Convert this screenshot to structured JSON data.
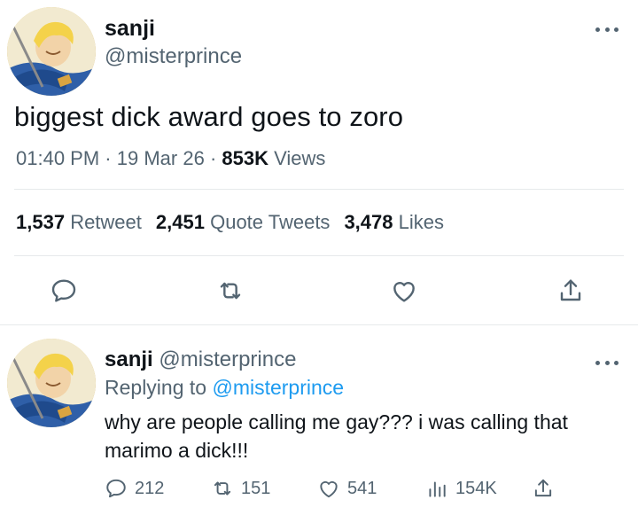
{
  "tweet": {
    "display_name": "sanji",
    "handle": "@misterprince",
    "text": "biggest dick award goes to zoro",
    "time": "01:40 PM",
    "date": "19 Mar 26",
    "views_count": "853K",
    "views_label": "Views",
    "stats": {
      "retweets_count": "1,537",
      "retweets_label": "Retweet",
      "quotes_count": "2,451",
      "quotes_label": "Quote Tweets",
      "likes_count": "3,478",
      "likes_label": "Likes"
    },
    "actions": [
      "reply",
      "retweet",
      "like",
      "share"
    ]
  },
  "reply": {
    "display_name": "sanji",
    "handle": "@misterprince",
    "replying_label": "Replying to",
    "replying_to": "@misterprince",
    "text": "why are people calling me gay??? i was calling that marimo a dick!!!",
    "actions": {
      "replies": "212",
      "retweets": "151",
      "likes": "541",
      "views": "154K"
    }
  },
  "colors": {
    "text": "#0f1419",
    "secondary": "#536471",
    "link": "#1d9bf0",
    "divider": "#e6e9eb"
  },
  "icons": [
    "more-icon",
    "reply-icon",
    "retweet-icon",
    "heart-icon",
    "share-icon",
    "views-icon"
  ]
}
